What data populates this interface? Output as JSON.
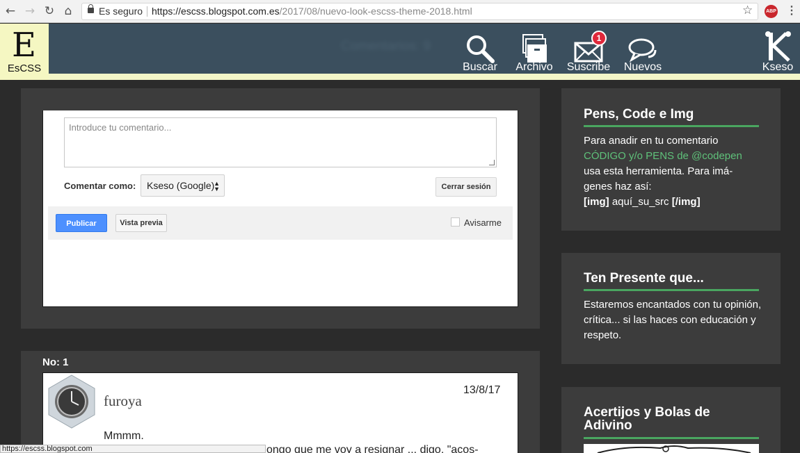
{
  "browser": {
    "secure_label": "Es seguro",
    "url_host": "https://escss.blogspot.com.es",
    "url_path": "/2017/08/nuevo-look-escss-theme-2018.html",
    "abp_label": "ABP",
    "status_url": "https://escss.blogspot.com"
  },
  "header": {
    "logo_glyph": "E",
    "logo_text": "EsCSS",
    "blurred_text": "Comentarios: 9",
    "nav": [
      {
        "label": "Buscar",
        "icon": "search-icon"
      },
      {
        "label": "Archivo",
        "icon": "archive-icon"
      },
      {
        "label": "Suscribe",
        "icon": "mail-icon",
        "badge": "1"
      },
      {
        "label": "Nuevos",
        "icon": "comments-icon"
      }
    ],
    "brand_label": "Kseso"
  },
  "comment_form": {
    "placeholder": "Introduce tu comentario...",
    "comment_as_label": "Comentar como:",
    "identity": "Kseso (Google)",
    "close_session": "Cerrar sesión",
    "publish": "Publicar",
    "preview": "Vista previa",
    "notify": "Avisarme"
  },
  "comments": {
    "number_label": "No: 1",
    "items": [
      {
        "author": "furoya",
        "date": "13/8/17",
        "line1": "Mmmm.",
        "line2": "ongo que me voy a resignar ... digo, \"acos-"
      }
    ]
  },
  "sidebar": {
    "widgets": [
      {
        "title": "Pens, Code e Img",
        "line1": "Para anadir en tu comentario",
        "line2": "CÓDIGO y/o PENS de @codepen",
        "line3": "usa esta herramienta. Para imá-",
        "line4": "genes haz así:",
        "line5_a": "[img]",
        "line5_b": " aquí_su_src ",
        "line5_c": "[/img]"
      },
      {
        "title": "Ten Presente que...",
        "text": "Estaremos encantados con tu opinión, crítica... si las haces con educación y respeto."
      },
      {
        "title": "Acertijos y Bolas de Adivino"
      }
    ]
  },
  "colors": {
    "header_bg": "#3b4f5e",
    "accent_green": "#4aa660",
    "publish_blue": "#4d90fe",
    "badge_red": "#e0283b"
  }
}
